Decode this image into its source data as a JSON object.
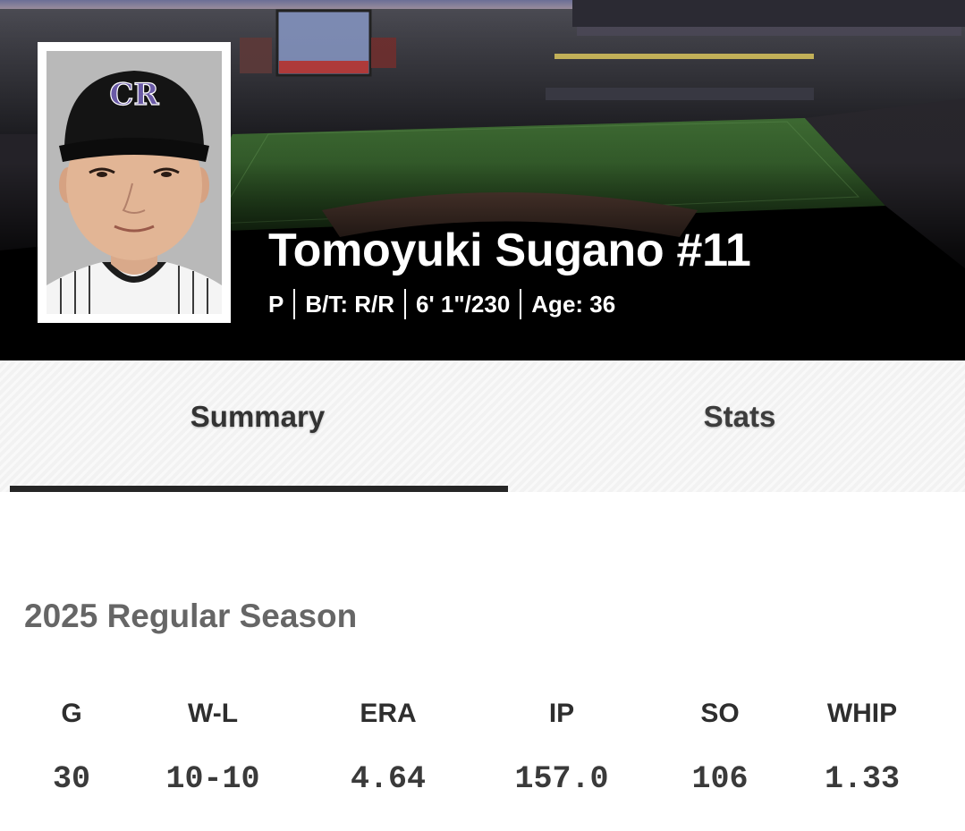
{
  "player": {
    "name": "Tomoyuki Sugano #11",
    "position": "P",
    "bats_throws": "B/T: R/R",
    "height_weight": "6' 1\"/230",
    "age": "Age: 36",
    "cap_logo": "CR"
  },
  "tabs": [
    {
      "label": "Summary",
      "active": true
    },
    {
      "label": "Stats",
      "active": false
    }
  ],
  "season": {
    "title": "2025 Regular Season",
    "columns": [
      "G",
      "W-L",
      "ERA",
      "IP",
      "SO",
      "WHIP"
    ],
    "values": [
      "30",
      "10-10",
      "4.64",
      "157.0",
      "106",
      "1.33"
    ]
  },
  "colors": {
    "tab_active_underline": "#262626",
    "tab_background": "#f2f2f2",
    "season_title": "#666666"
  }
}
